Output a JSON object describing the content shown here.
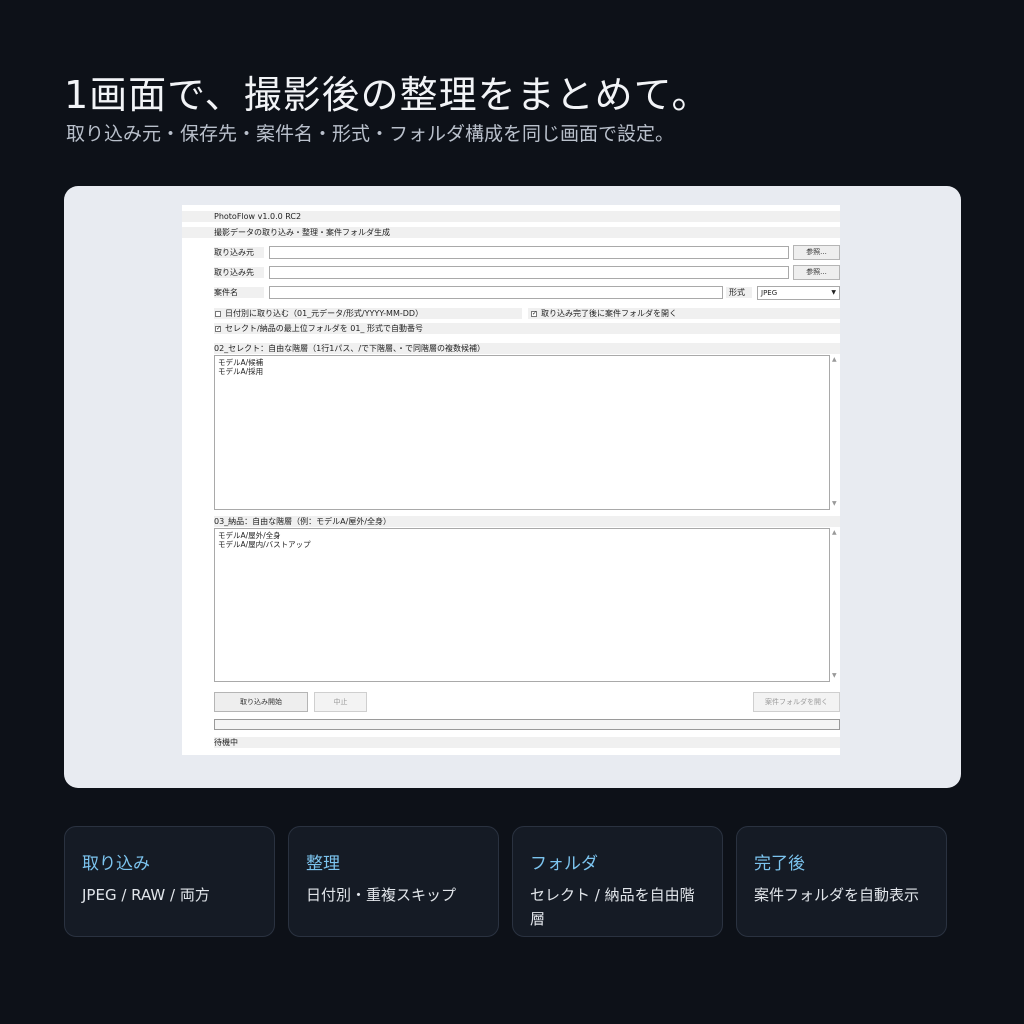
{
  "hero": {
    "title": "1画面で、撮影後の整理をまとめて。",
    "subtitle": "取り込み元・保存先・案件名・形式・フォルダ構成を同じ画面で設定。"
  },
  "app": {
    "title": "PhotoFlow v1.0.0 RC2",
    "description": "撮影データの取り込み・整理・案件フォルダ生成",
    "source_label": "取り込み元",
    "source_value": "",
    "dest_label": "取り込み先",
    "dest_value": "",
    "browse_label": "参照...",
    "project_label": "案件名",
    "project_value": "",
    "format_label": "形式",
    "format_value": "JPEG",
    "opt_by_date": "日付別に取り込む（01_元データ/形式/YYYY-MM-DD）",
    "opt_by_date_checked": false,
    "opt_open_after": "取り込み完了後に案件フォルダを開く",
    "opt_open_after_checked": true,
    "opt_prefix": "セレクト/納品の最上位フォルダを 01_ 形式で自動番号",
    "opt_prefix_checked": true,
    "select_label": "02_セレクト：自由な階層（1行1パス、/で下階層、・で同階層の複数候補）",
    "select_lines": [
      "モデルA/候補",
      "モデルA/採用"
    ],
    "delivery_label": "03_納品：自由な階層（例：モデルA/屋外/全身）",
    "delivery_lines": [
      "モデルA/屋外/全身",
      "モデルA/屋内/バストアップ"
    ],
    "start_button": "取り込み開始",
    "stop_button": "中止",
    "open_folder_button": "案件フォルダを開く",
    "progress": 0,
    "status": "待機中"
  },
  "cards": [
    {
      "title": "取り込み",
      "body": "JPEG / RAW / 両方"
    },
    {
      "title": "整理",
      "body": "日付別・重複スキップ"
    },
    {
      "title": "フォルダ",
      "body": "セレクト / 納品を自由階層"
    },
    {
      "title": "完了後",
      "body": "案件フォルダを自動表示"
    }
  ],
  "colors": {
    "background": "#0d1118",
    "accent": "#7cc4ef",
    "card_bg": "#151b25",
    "panel_bg": "#e8ebf1"
  }
}
